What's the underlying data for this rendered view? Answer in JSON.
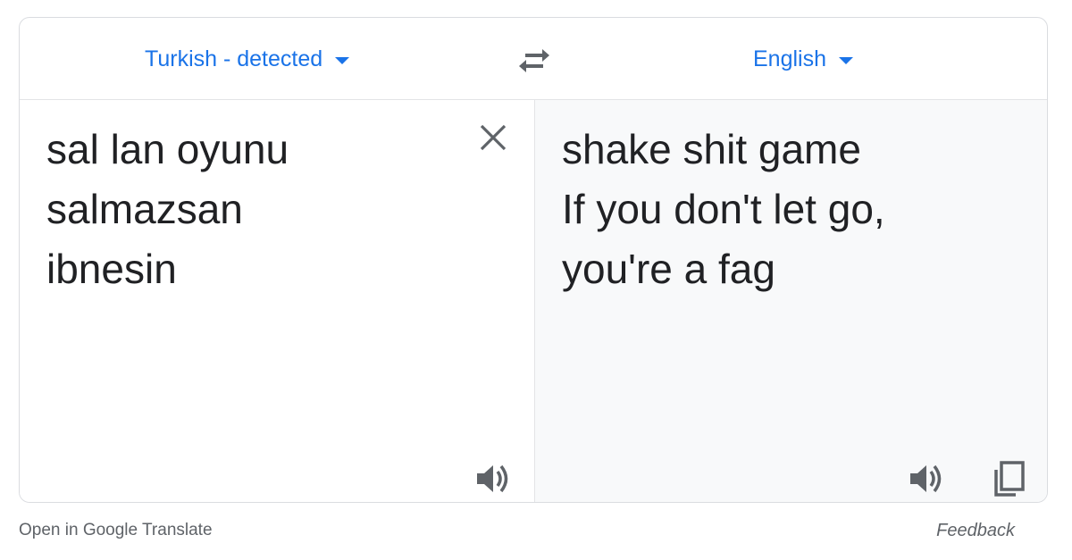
{
  "languages": {
    "source_label": "Turkish - detected",
    "target_label": "English"
  },
  "source": {
    "text": "sal lan oyunu\nsalmazsan\nibnesin"
  },
  "target": {
    "text": "shake shit game\nIf you don't let go,\nyou're a fag"
  },
  "footer": {
    "open_link": "Open in Google Translate",
    "feedback": "Feedback"
  },
  "icons": {
    "swap": "swap-arrows-icon",
    "clear": "close-icon",
    "speak": "speaker-icon",
    "copy": "copy-icon"
  },
  "colors": {
    "accent": "#1a73e8",
    "text": "#202124",
    "muted": "#5f6368",
    "icon": "#5f6368",
    "result_bg": "#f8f9fa",
    "border": "#dadce0"
  }
}
